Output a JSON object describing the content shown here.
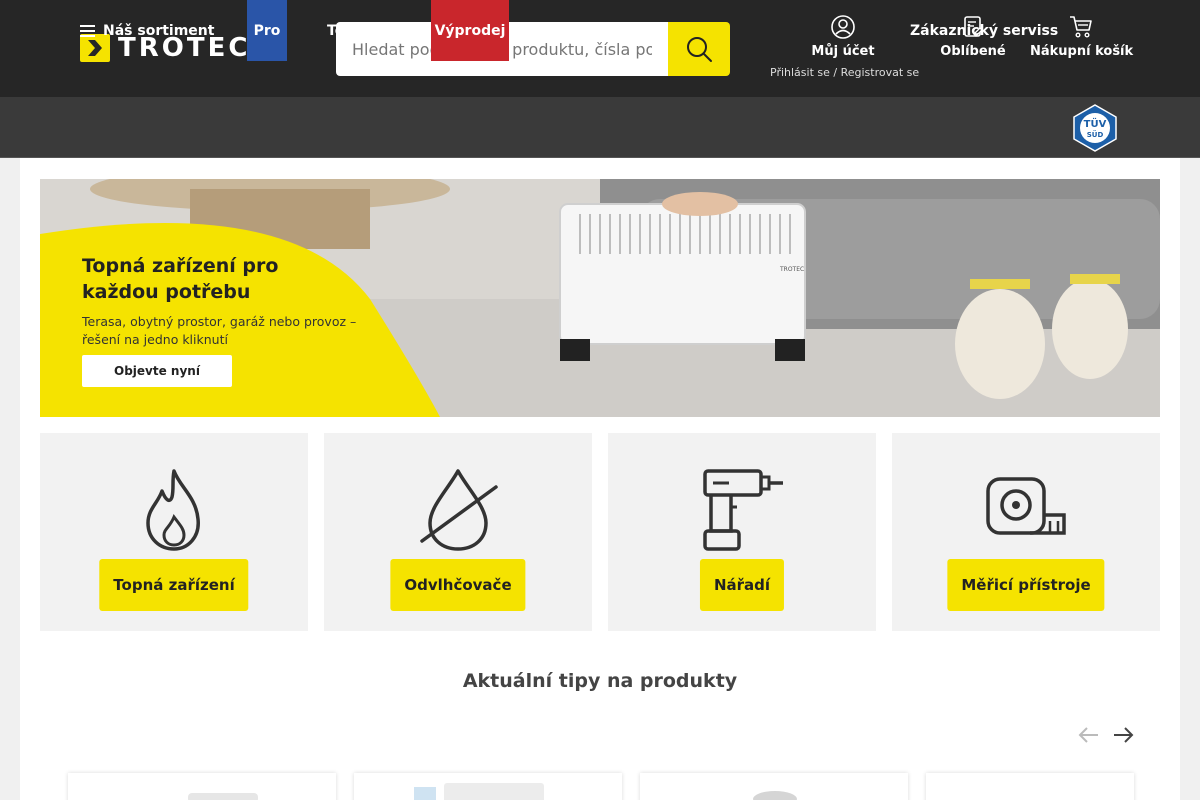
{
  "header": {
    "logo_text": "TROTEC",
    "search": {
      "placeholder": "Hledat podle názvu produktu, čísla položky"
    },
    "account": {
      "label": "Můj účet",
      "sub": "Přihlásit se / Registrovat se",
      "icon": "user-circle-icon"
    },
    "favorites": {
      "label": "Oblíbené",
      "icon": "favorites-list-icon"
    },
    "cart": {
      "label": "Nákupní košík",
      "icon": "cart-icon"
    }
  },
  "nav": {
    "sortiment": "Náš sortiment",
    "pro": "Pro",
    "topseller": "Topseller",
    "sale": "Výprodej",
    "service": "Zákaznický serviss",
    "badge": "TÜV SÜD"
  },
  "hero": {
    "title": "Topná zařízení pro každou potřebu",
    "subtitle": "Terasa, obytný prostor, garáž nebo provoz – řešení na jedno kliknutí",
    "cta": "Objevte nyní",
    "product_brand": "TROTEC"
  },
  "categories": [
    {
      "label": "Topná zařízení",
      "icon": "flame-icon"
    },
    {
      "label": "Odvlhčovače",
      "icon": "crossed-drop-icon"
    },
    {
      "label": "Nářadí",
      "icon": "drill-icon"
    },
    {
      "label": "Měřicí přístroje",
      "icon": "tape-measure-icon"
    }
  ],
  "tips": {
    "title": "Aktuální tipy na produkty"
  },
  "colors": {
    "brand_yellow": "#f5e300",
    "header_dark": "#262626",
    "nav_dark": "#3a3a3a",
    "pro_blue": "#2a55a8",
    "sale_red": "#c9262c"
  }
}
